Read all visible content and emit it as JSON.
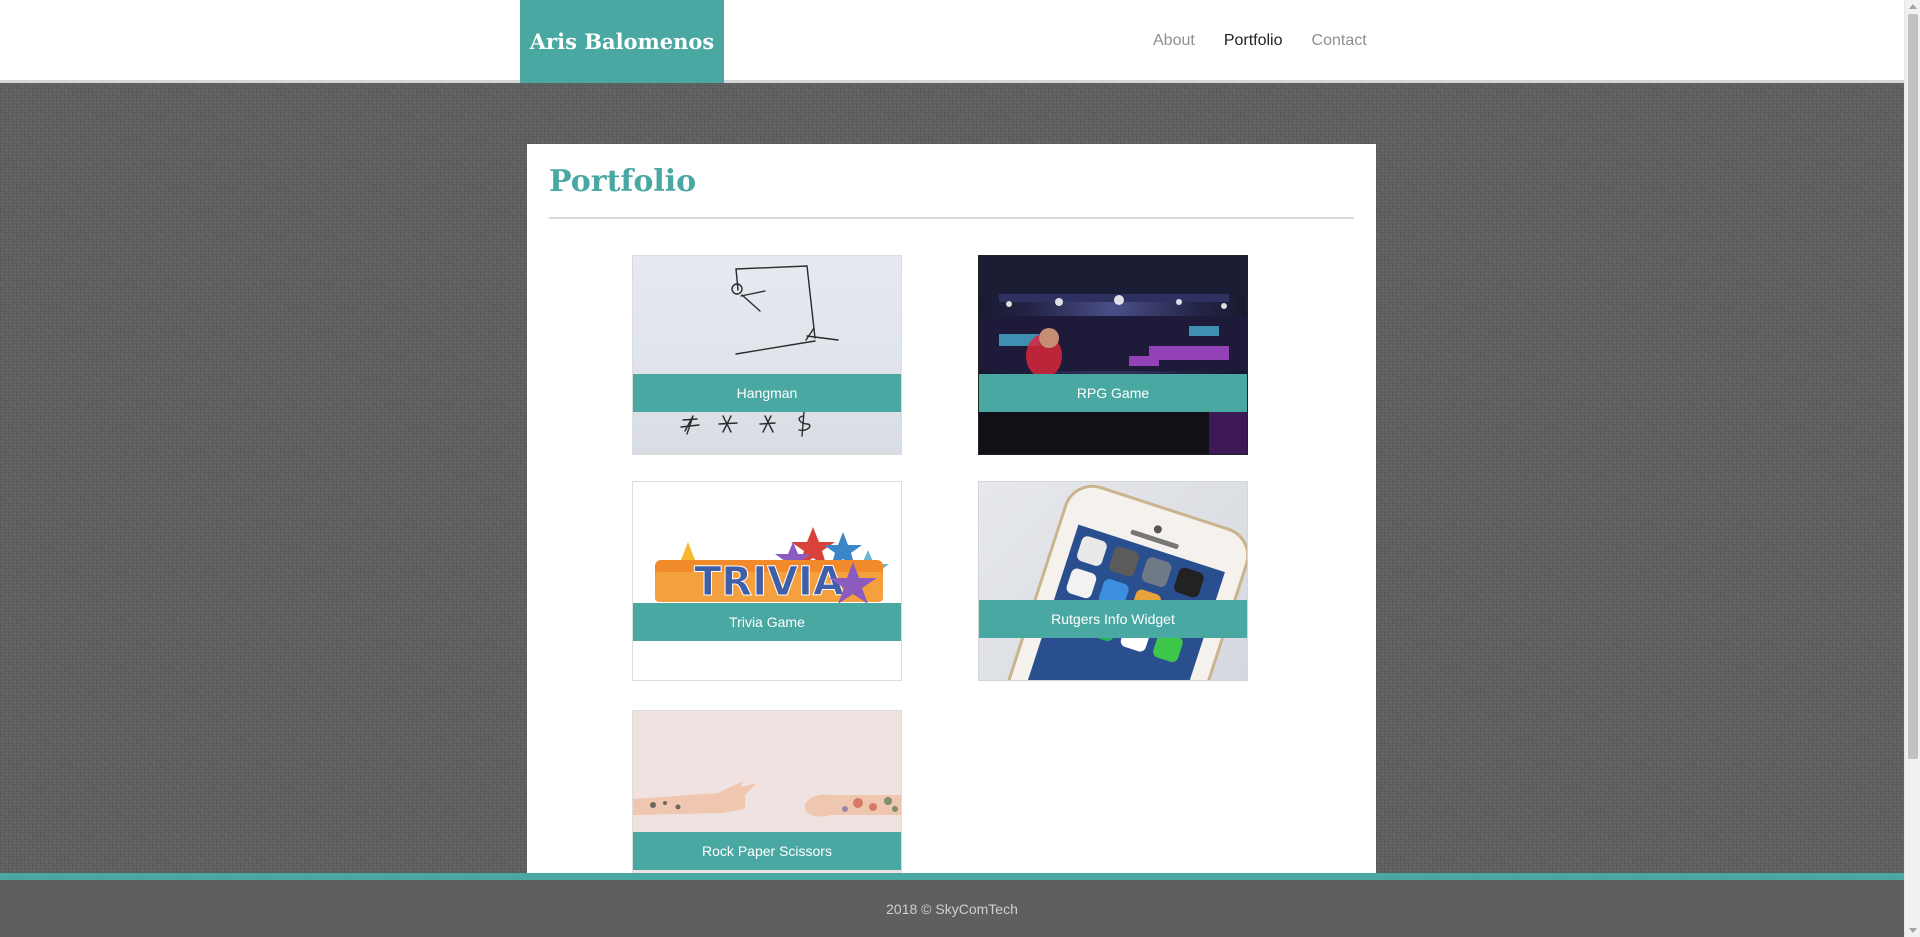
{
  "header": {
    "brand": "Aris Balomenos",
    "nav": [
      {
        "label": "About",
        "active": false
      },
      {
        "label": "Portfolio",
        "active": true
      },
      {
        "label": "Contact",
        "active": false
      }
    ]
  },
  "main": {
    "title": "Portfolio",
    "projects": [
      {
        "label": "Hangman",
        "image": "hangman-sketch"
      },
      {
        "label": "RPG Game",
        "image": "gaming-arena-photo"
      },
      {
        "label": "Trivia Game",
        "image": "trivia-logo"
      },
      {
        "label": "Rutgers Info Widget",
        "image": "smartphone-apps-photo"
      },
      {
        "label": "Rock Paper Scissors",
        "image": "hands-rock-paper-scissors-photo"
      }
    ]
  },
  "footer": {
    "text": "2018 © SkyComTech"
  },
  "colors": {
    "accent": "#4aa8a3",
    "background": "#5e5e5e",
    "footer": "#5f5f5f"
  }
}
